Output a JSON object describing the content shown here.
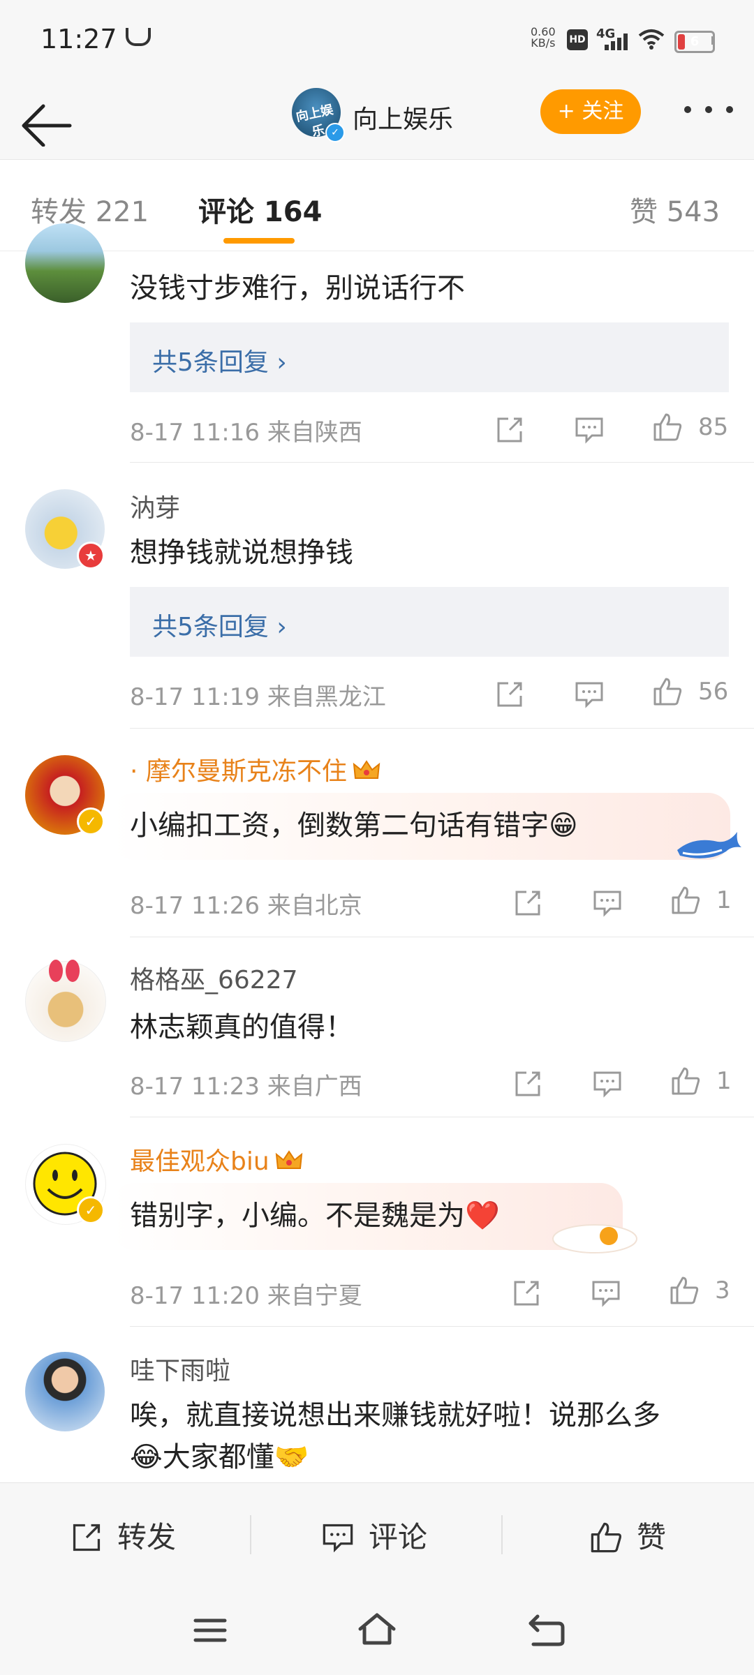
{
  "status_bar": {
    "time": "11:27",
    "speed_value": "0.60",
    "speed_unit": "KB/s",
    "hd": "HD",
    "network": "4G",
    "battery": "6"
  },
  "header": {
    "account_name": "向上娱乐",
    "avatar_logo_text": "向上娱乐",
    "follow_label": "+ 关注"
  },
  "tabs": [
    {
      "label": "转发 221",
      "active": false
    },
    {
      "label": "评论 164",
      "active": true
    },
    {
      "label": "赞 543",
      "active": false
    }
  ],
  "comments": [
    {
      "text": "没钱寸步难行，别说话行不",
      "replies": "共5条回复 ›",
      "time": "8-17 11:16",
      "location": "来自陕西",
      "likes": "85"
    },
    {
      "user": "汭芽",
      "text": "想挣钱就说想挣钱",
      "replies": "共5条回复 ›",
      "time": "8-17 11:19",
      "location": "来自黑龙江",
      "likes": "56"
    },
    {
      "user": "· 摩尔曼斯克冻不住",
      "text": "小编扣工资，倒数第二句话有错字😁",
      "time": "8-17 11:26",
      "location": "来自北京",
      "likes": "1"
    },
    {
      "user": "格格巫_66227",
      "text": "林志颖真的值得！",
      "time": "8-17 11:23",
      "location": "来自广西",
      "likes": "1"
    },
    {
      "user": "最佳观众biu",
      "text": "错别字，小编。不是魏是为❤️",
      "time": "8-17 11:20",
      "location": "来自宁夏",
      "likes": "3"
    },
    {
      "user": "哇下雨啦",
      "text_line1": "唉，就直接说想出来赚钱就好啦！说那么多",
      "text_line2": "😂大家都懂🤝"
    }
  ],
  "bottom_bar": {
    "repost": "转发",
    "comment": "评论",
    "like": "赞"
  },
  "colors": {
    "accent_orange": "#ff9a00",
    "link_blue": "#3b6ea8",
    "vip_orange": "#e8821a",
    "verified_blue": "#2a9ae8",
    "verified_yellow": "#f5b800"
  },
  "icons": [
    "back-arrow-icon",
    "more-dots-icon",
    "share-icon",
    "comment-icon",
    "like-icon",
    "menu-icon",
    "home-icon",
    "back-nav-icon"
  ]
}
